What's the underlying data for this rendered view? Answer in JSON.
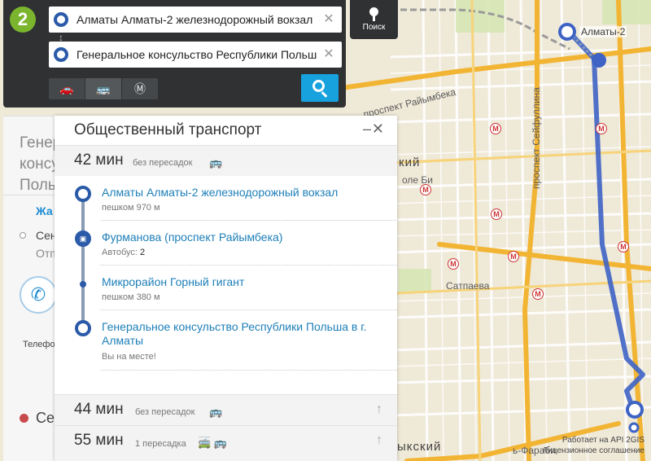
{
  "search": {
    "logo_text": "2",
    "from_value": "Алматы Алматы-2 железнодорожный вокзал",
    "to_value": "Генеральное консульство Республики Польша в г. Алматы",
    "clear_glyph": "✕",
    "swap_glyph": "↕",
    "modes": [
      {
        "icon": "car-icon",
        "glyph": "🚗"
      },
      {
        "icon": "bus-icon",
        "glyph": "🚌"
      },
      {
        "icon": "metro-icon",
        "glyph": "Ⓜ"
      }
    ],
    "poisk_label": "Поиск"
  },
  "route": {
    "title": "Общественный транспорт",
    "minimize_glyph": "–",
    "close_glyph": "✕",
    "selected": {
      "duration": "42 мин",
      "note": "без пересадок",
      "transport_icon": "🚌"
    },
    "steps": [
      {
        "name": "Алматы Алматы-2 железнодорожный вокзал",
        "sub": "пешком 970 м",
        "sub_value": "",
        "marker": "start-marker-icon"
      },
      {
        "name": "Фурманова (проспект Райымбека)",
        "sub": "Автобус:",
        "sub_value": "2",
        "marker": "bus-stop-icon"
      },
      {
        "name": "Микрорайон Горный гигант",
        "sub": "пешком 380 м",
        "sub_value": "",
        "marker": "waypoint-icon"
      },
      {
        "name": "Генеральное консульство Республики Польша в г. Алматы",
        "sub": "Вы на месте!",
        "sub_value": "",
        "marker": "finish-marker-icon"
      }
    ],
    "alternatives": [
      {
        "duration": "44 мин",
        "note": "без пересадок",
        "icons": "🚌"
      },
      {
        "duration": "55 мин",
        "note": "1 пересадка",
        "icons": "🚎 🚌"
      }
    ],
    "arrow_glyph": "↑"
  },
  "background_card": {
    "title": "Генеральное консульство Польши",
    "rows": [
      "Жа",
      "Сен",
      "Отп"
    ],
    "phone_label": "Телефон",
    "schedule_label": "Се"
  },
  "map": {
    "labels": {
      "prospekt_raiymbeka": "проспект Райымбека",
      "prospekt_seifullina": "проспект Сейфуллина",
      "olebi": "оле Би",
      "satpaeva": "Сатпаева",
      "district_ky": "кий",
      "district_bottom": "ыкский",
      "al_farabi": "ь-Фараби",
      "almaty2": "Алматы-2"
    },
    "metro_glyph": "М",
    "attribution_line1": "Работает на API 2GIS",
    "attribution_line2": "Лицензионное соглашение",
    "colors": {
      "background": "#efe9d8",
      "major_road": "#f2b433",
      "route": "#3e63c5",
      "accent": "#17a1dd",
      "panel_dark": "#2f3133"
    }
  }
}
